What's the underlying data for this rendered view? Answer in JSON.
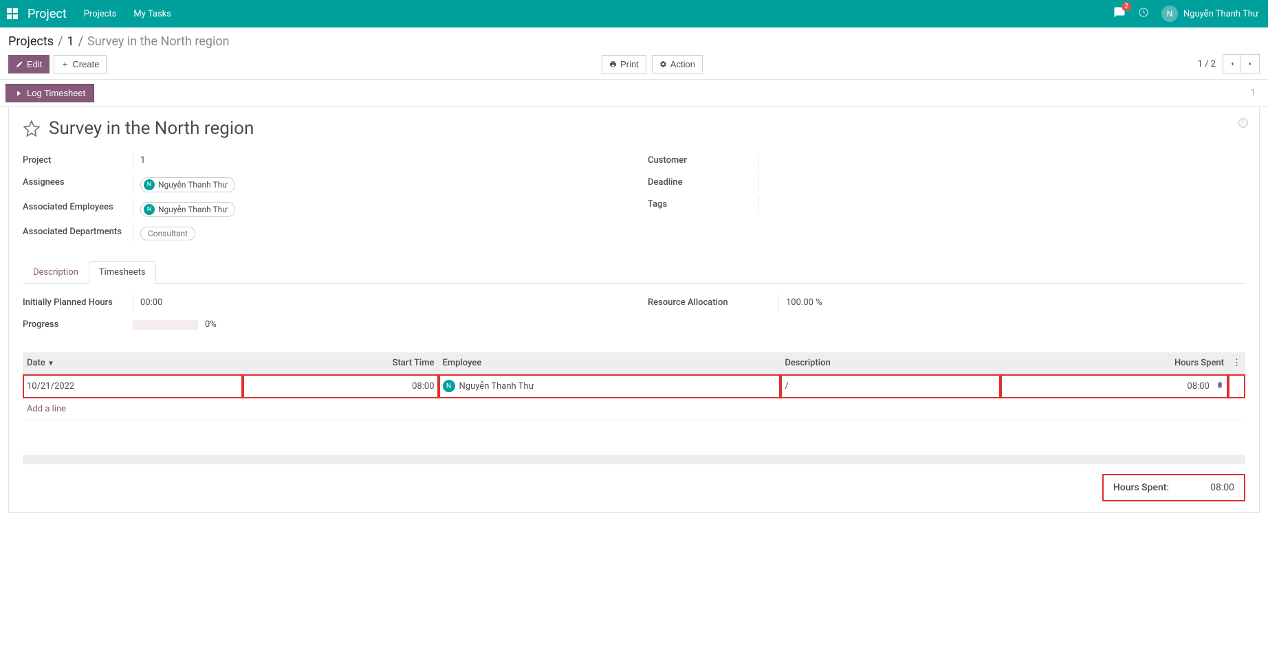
{
  "nav": {
    "brand": "Project",
    "links": [
      "Projects",
      "My Tasks"
    ],
    "chat_badge": "2",
    "user_initial": "N",
    "username": "Nguyễn Thanh Thư"
  },
  "breadcrumb": {
    "root": "Projects",
    "mid": "1",
    "current": "Survey in the North region"
  },
  "toolbar": {
    "edit": "Edit",
    "create": "Create",
    "print": "Print",
    "action": "Action",
    "pager_text": "1 / 2"
  },
  "statusbar": {
    "log_btn": "Log Timesheet",
    "stage": "1"
  },
  "title": "Survey in the North region",
  "fields_left": {
    "project_label": "Project",
    "project_value": "1",
    "assignees_label": "Assignees",
    "assignee_name": "Nguyễn Thanh Thư",
    "employees_label": "Associated Employees",
    "employee_name": "Nguyễn Thanh Thư",
    "departments_label": "Associated Departments",
    "department_tag": "Consultant"
  },
  "fields_right": {
    "customer_label": "Customer",
    "deadline_label": "Deadline",
    "tags_label": "Tags"
  },
  "tabs": {
    "description": "Description",
    "timesheets": "Timesheets"
  },
  "tabfields": {
    "planned_label": "Initially Planned Hours",
    "planned_value": "00:00",
    "progress_label": "Progress",
    "progress_value": "0%",
    "allocation_label": "Resource Allocation",
    "allocation_value": "100.00 %"
  },
  "table": {
    "cols": {
      "date": "Date",
      "start": "Start Time",
      "employee": "Employee",
      "desc": "Description",
      "hours": "Hours Spent"
    },
    "row": {
      "date": "10/21/2022",
      "start": "08:00",
      "emp_initial": "N",
      "emp_name": "Nguyễn Thanh Thư",
      "desc": "/",
      "hours": "08:00"
    },
    "add_line": "Add a line"
  },
  "footer": {
    "label": "Hours Spent:",
    "value": "08:00"
  }
}
